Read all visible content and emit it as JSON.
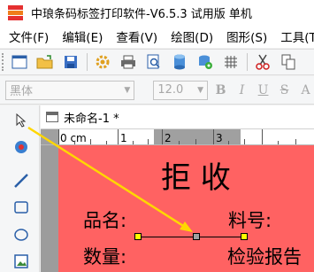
{
  "window": {
    "title": "中琅条码标签打印软件-V6.5.3 试用版 单机"
  },
  "menu": {
    "items": [
      "文件(F)",
      "编辑(E)",
      "查看(V)",
      "绘图(D)",
      "图形(S)",
      "工具(T)"
    ]
  },
  "toolbar": {
    "icons": [
      "new-icon",
      "open-icon",
      "save-icon",
      "settings-icon",
      "print-icon",
      "print-preview-icon",
      "database-icon",
      "database-settings-icon",
      "grid-icon",
      "cut-icon",
      "copy-icon"
    ]
  },
  "format_bar": {
    "font_family": "黑体",
    "font_size": "12.0",
    "buttons": [
      "B",
      "I",
      "U",
      "S",
      "A"
    ]
  },
  "document": {
    "tab_label": "未命名-1 *"
  },
  "ruler": {
    "unit_label": "0 cm",
    "marks": [
      "1",
      "2",
      "3"
    ]
  },
  "label": {
    "title": "拒    收",
    "product_name_label": "品名:",
    "material_no_label": "料号:",
    "quantity_label": "数量:",
    "report_label": "检验报告"
  },
  "colors": {
    "label_background": "#ff6262",
    "accent_yellow": "#ffd700",
    "selection_handle_yellow": "#ffff00"
  }
}
